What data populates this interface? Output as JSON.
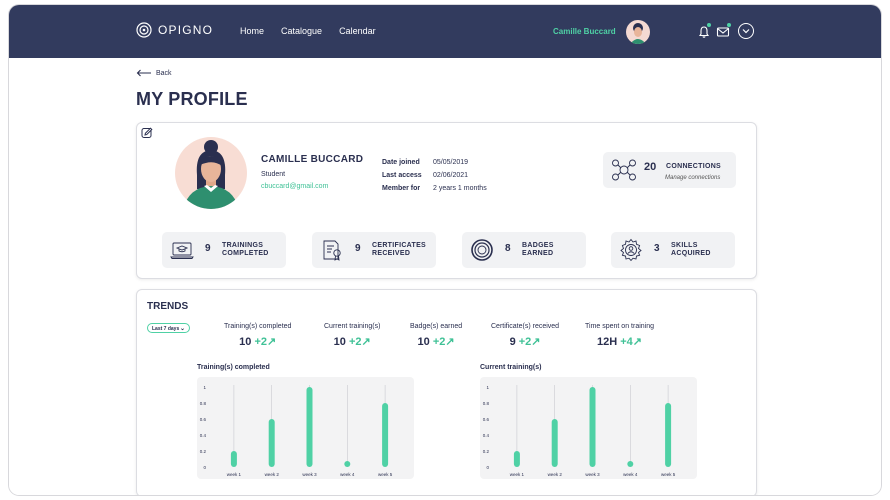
{
  "app": {
    "logo_text": "OPIGNO",
    "nav": [
      "Home",
      "Catalogue",
      "Calendar"
    ],
    "user_name": "Camille Buccard"
  },
  "page": {
    "back_label": "Back",
    "title": "MY PROFILE"
  },
  "profile": {
    "name": "CAMILLE BUCCARD",
    "role": "Student",
    "email": "cbuccard@gmail.com",
    "meta": [
      {
        "label": "Date joined",
        "value": "05/05/2019"
      },
      {
        "label": "Last access",
        "value": "02/06/2021"
      },
      {
        "label": "Member for",
        "value": "2 years 1 months"
      }
    ],
    "connections": {
      "count": "20",
      "label": "CONNECTIONS",
      "link": "Manage connections"
    }
  },
  "stats": [
    {
      "num": "9",
      "line1": "TRAININGS",
      "line2": "COMPLETED",
      "icon": "laptop-graduation-icon"
    },
    {
      "num": "9",
      "line1": "CERTIFICATES",
      "line2": "RECEIVED",
      "icon": "certificate-icon"
    },
    {
      "num": "8",
      "line1": "BADGES",
      "line2": "EARNED",
      "icon": "badge-icon"
    },
    {
      "num": "3",
      "line1": "SKILLS",
      "line2": "ACQUIRED",
      "icon": "skills-gear-icon"
    }
  ],
  "trends": {
    "title": "TRENDS",
    "period": "Last 7 days",
    "kpis": [
      {
        "label": "Training(s) completed",
        "value": "10",
        "delta": "+2"
      },
      {
        "label": "Current training(s)",
        "value": "10",
        "delta": "+2"
      },
      {
        "label": "Badge(s) earned",
        "value": "10",
        "delta": "+2"
      },
      {
        "label": "Certificate(s) received",
        "value": "9",
        "delta": "+2"
      },
      {
        "label": "Time spent on training",
        "value": "12H",
        "delta": "+4"
      }
    ]
  },
  "colors": {
    "navy": "#323b5e",
    "accent": "#4fd1a5",
    "text": "#2a2f4f"
  },
  "chart_data": [
    {
      "type": "bar",
      "title": "Training(s) completed",
      "categories": [
        "week 1",
        "week 2",
        "week 3",
        "week 4",
        "week 5"
      ],
      "values": [
        0.2,
        0.6,
        1.0,
        0.05,
        0.8
      ],
      "yticks": [
        "0",
        "0.2",
        "0.4",
        "0.6",
        "0.8",
        "1"
      ],
      "ylim": [
        0,
        1
      ],
      "grid": "vertical"
    },
    {
      "type": "bar",
      "title": "Current training(s)",
      "categories": [
        "week 1",
        "week 2",
        "week 3",
        "week 4",
        "week 5"
      ],
      "values": [
        0.2,
        0.6,
        1.0,
        0.05,
        0.8
      ],
      "yticks": [
        "0",
        "0.2",
        "0.4",
        "0.6",
        "0.8",
        "1"
      ],
      "ylim": [
        0,
        1
      ],
      "grid": "vertical"
    }
  ]
}
